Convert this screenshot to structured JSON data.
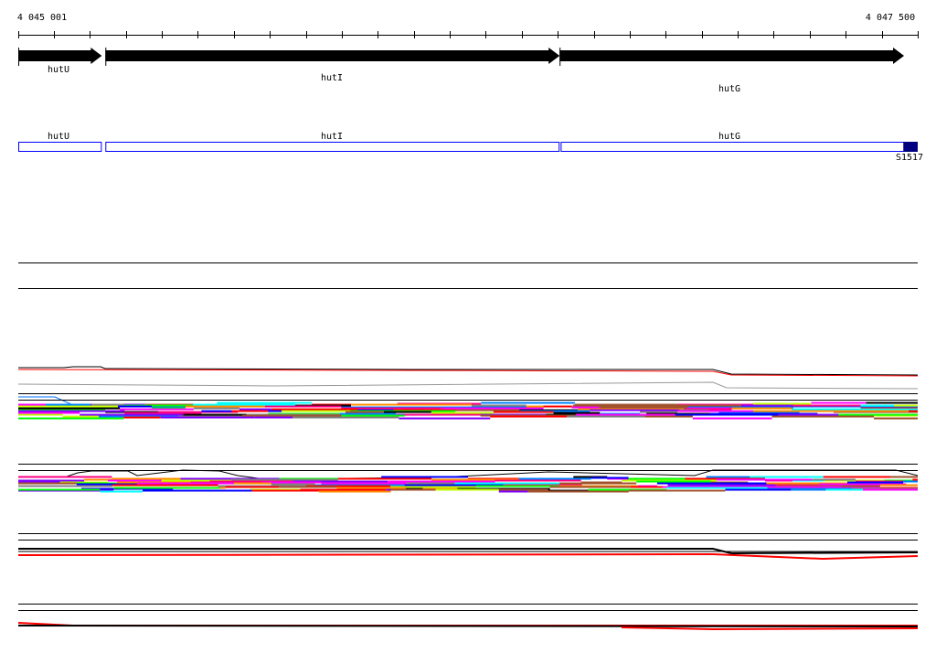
{
  "axis": {
    "start_label": "4 045 001",
    "end_label": "4 047 500",
    "start": 4045001,
    "end": 4047500,
    "tick_interval_bp": 100
  },
  "genes": [
    {
      "name": "hutU",
      "start": 4045001,
      "end": 4045233,
      "strand": "+"
    },
    {
      "name": "hutI",
      "start": 4045243,
      "end": 4046505,
      "strand": "+"
    },
    {
      "name": "hutG",
      "start": 4046505,
      "end": 4047462,
      "strand": "+"
    }
  ],
  "annotation_track": {
    "features": [
      {
        "name": "hutU",
        "start": 4045001,
        "end": 4045233
      },
      {
        "name": "hutI",
        "start": 4045243,
        "end": 4046505
      },
      {
        "name": "hutG",
        "start": 4046508,
        "end": 4047500
      }
    ],
    "marker": {
      "name": "S1517",
      "start": 4047460,
      "end": 4047500,
      "color": "#000080"
    }
  },
  "colors": {
    "gene": "#000000",
    "feature_box": "#0000ff"
  }
}
